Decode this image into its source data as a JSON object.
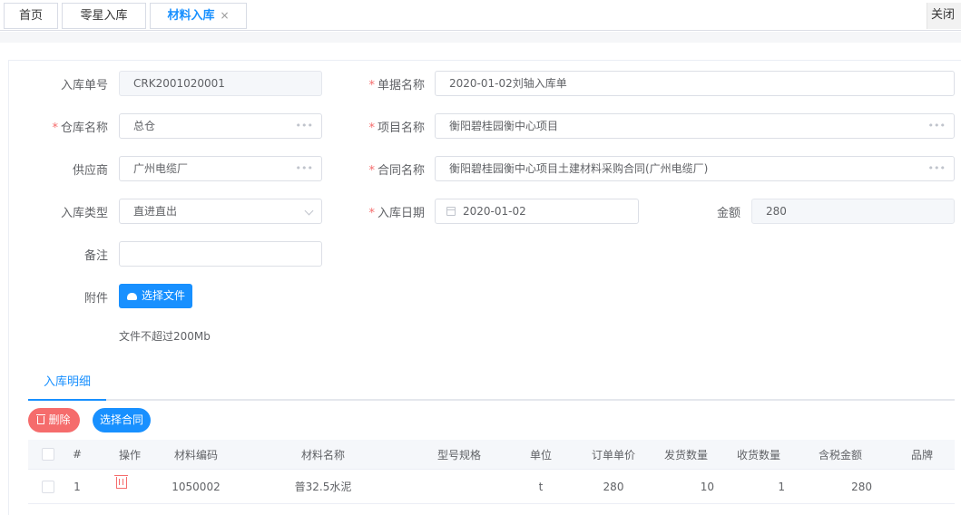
{
  "tabs": [
    {
      "label": "首页"
    },
    {
      "label": "零星入库"
    },
    {
      "label": "材料入库",
      "close": "×"
    }
  ],
  "close_all": "关闭",
  "form": {
    "receipt_no": {
      "label": "入库单号",
      "value": "CRK2001020001"
    },
    "doc_name": {
      "label": "单据名称",
      "value": "2020-01-02刘轴入库单"
    },
    "warehouse": {
      "label": "仓库名称",
      "value": "总仓"
    },
    "project": {
      "label": "项目名称",
      "value": "衡阳碧桂园衡中心项目"
    },
    "supplier": {
      "label": "供应商",
      "value": "广州电缆厂"
    },
    "contract": {
      "label": "合同名称",
      "value": "衡阳碧桂园衡中心项目土建材料采购合同(广州电缆厂)"
    },
    "type": {
      "label": "入库类型",
      "value": "直进直出"
    },
    "date": {
      "label": "入库日期",
      "value": "2020-01-02"
    },
    "amount": {
      "label": "金额",
      "value": "280"
    },
    "remark": {
      "label": "备注",
      "value": ""
    },
    "attachment": {
      "label": "附件",
      "button": "选择文件",
      "hint": "文件不超过200Mb"
    },
    "required_mark": "*",
    "more": "•••"
  },
  "detail_tab": "入库明细",
  "actions": {
    "delete": "删除",
    "pick_contract": "选择合同"
  },
  "table": {
    "headers": [
      "#",
      "操作",
      "材料编码",
      "材料名称",
      "型号规格",
      "单位",
      "订单单价",
      "发货数量",
      "收货数量",
      "含税金额",
      "品牌"
    ],
    "rows": [
      {
        "index": "1",
        "code": "1050002",
        "name": "普32.5水泥",
        "spec": "",
        "unit": "t",
        "price": "280",
        "shipped": "10",
        "received": "1",
        "amount": "280",
        "brand": ""
      }
    ]
  }
}
